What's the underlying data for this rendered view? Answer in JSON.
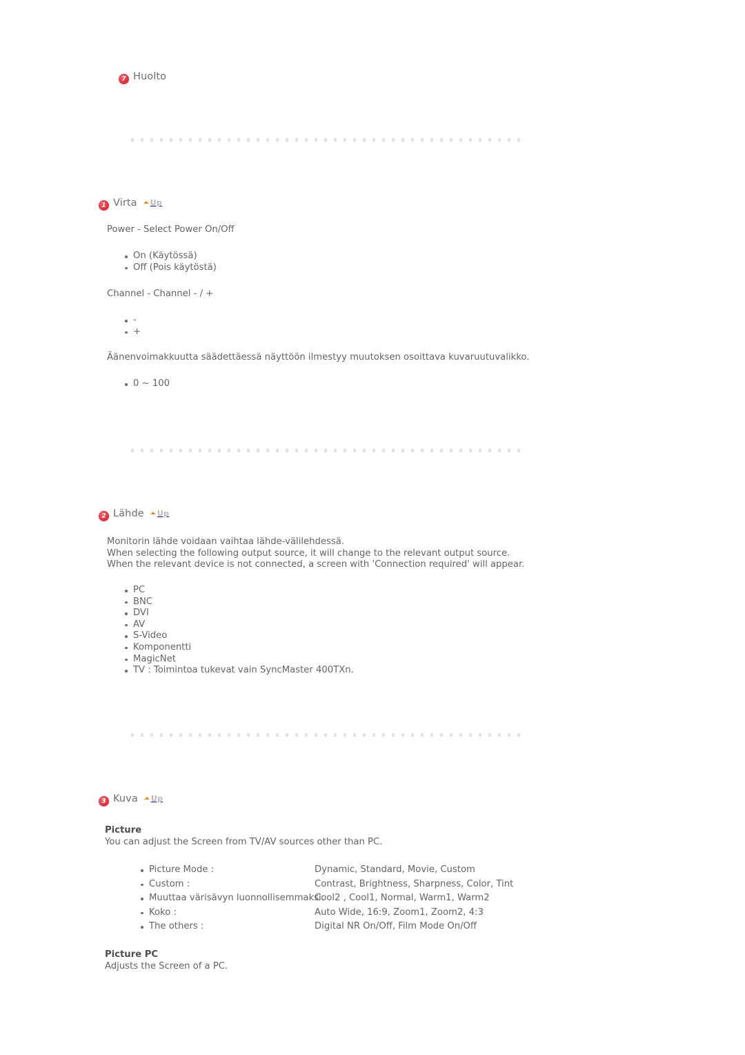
{
  "page": {
    "background": "#ffffff",
    "text_color": "#636466",
    "badge_color": "#e8343f",
    "up_arrow_color": "#f08a2e",
    "up_text_color": "#b8b8b8",
    "divider_color": "#e2e2e2"
  },
  "top_section": {
    "number": "7",
    "title": "Huolto"
  },
  "up_label": "Up",
  "sections": [
    {
      "number": "1",
      "title": "Virta",
      "power_heading": "Power - Select Power On/Off",
      "power_items": [
        "On (Käytössä)",
        "Off (Pois käytöstä)"
      ],
      "channel_heading": "Channel - Channel - / +",
      "channel_items": [
        "-",
        "+"
      ],
      "volume_text": "Äänenvoimakkuutta säädettäessä näyttöön ilmestyy muutoksen osoittava kuvaruutuvalikko.",
      "volume_items": [
        "0 ~ 100"
      ]
    },
    {
      "number": "2",
      "title": "Lähde",
      "paragraph_lines": [
        "Monitorin lähde voidaan vaihtaa lähde-välilehdessä.",
        "When selecting the following output source, it will change to the relevant output source.",
        "When the relevant device is not connected, a screen with 'Connection required' will appear."
      ],
      "sources": [
        "PC",
        "BNC",
        "DVI",
        "AV",
        "S-Video",
        "Komponentti",
        "MagicNet",
        "TV : Toimintoa tukevat vain SyncMaster 400TXn."
      ]
    },
    {
      "number": "3",
      "title": "Kuva",
      "picture_heading": "Picture",
      "picture_desc": "You can adjust the Screen from TV/AV sources other than PC.",
      "picture_rows": [
        {
          "term": "Picture Mode :",
          "value": "Dynamic, Standard, Movie, Custom"
        },
        {
          "term": "Custom :",
          "value": "Contrast, Brightness, Sharpness, Color, Tint"
        },
        {
          "term": "Muuttaa värisävyn luonnollisemmaksi.",
          "value": "Cool2 , Cool1, Normal, Warm1, Warm2"
        },
        {
          "term": "Koko :",
          "value": "Auto Wide, 16:9, Zoom1, Zoom2, 4:3"
        },
        {
          "term": "The others :",
          "value": "Digital NR On/Off, Film Mode On/Off"
        }
      ],
      "picture_pc_heading": "Picture PC",
      "picture_pc_desc": "Adjusts the Screen of a PC."
    }
  ]
}
